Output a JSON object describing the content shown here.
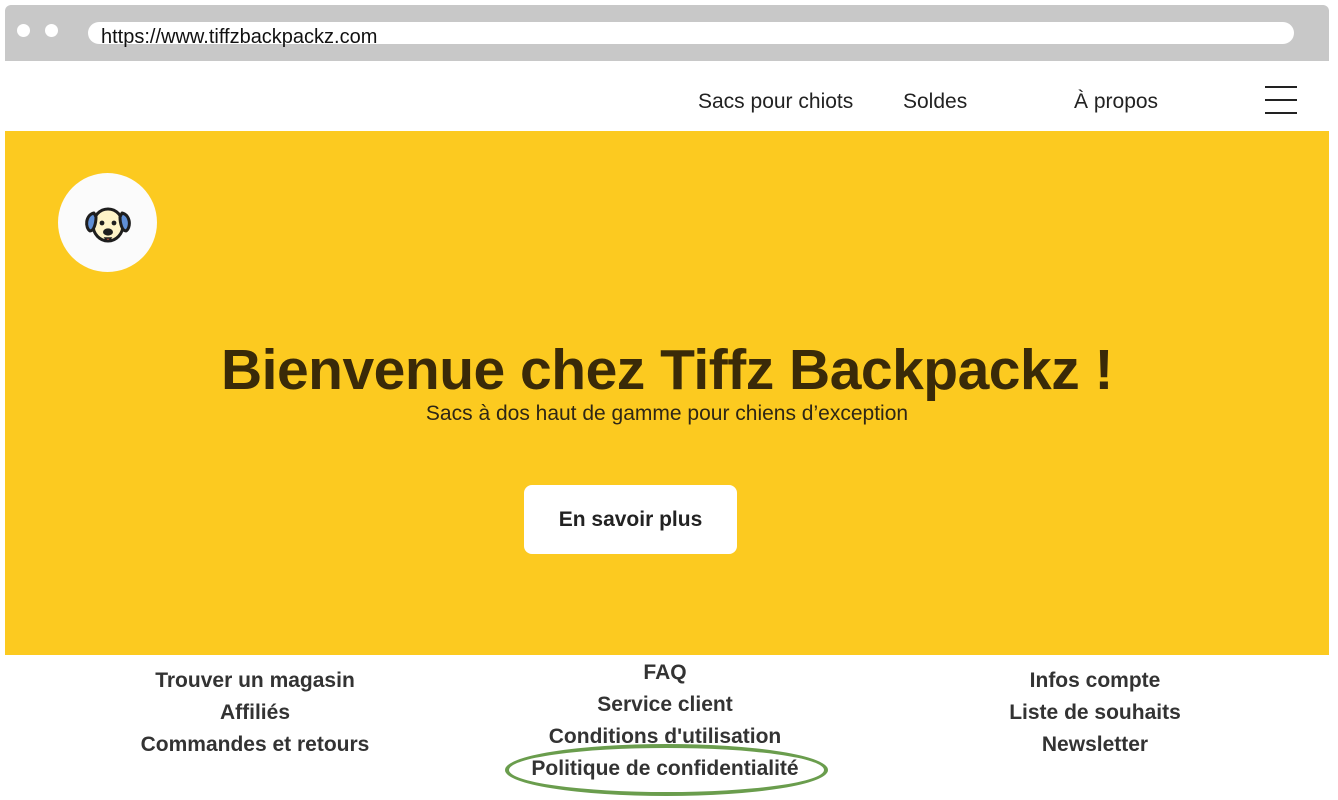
{
  "browser": {
    "url": "https://www.tiffzbackpackz.com"
  },
  "nav": {
    "items": [
      "Sacs pour chiots",
      "Soldes",
      "À propos"
    ],
    "menu_icon": "hamburger-menu-icon"
  },
  "hero": {
    "logo_icon": "dog-face-icon",
    "title": "Bienvenue chez Tiffz Backpackz !",
    "subtitle": "Sacs à dos haut de gamme pour chiens d’exception",
    "cta_label": "En savoir plus",
    "background_color": "#fcca20"
  },
  "footer": {
    "columns": [
      [
        "Trouver un magasin",
        "Affiliés",
        "Commandes et retours"
      ],
      [
        "FAQ",
        "Service client",
        "Conditions d'utilisation",
        "Politique de confidentialité"
      ],
      [
        "Infos compte",
        "Liste de souhaits",
        "Newsletter"
      ]
    ],
    "highlight_color": "#6a9d4d"
  }
}
